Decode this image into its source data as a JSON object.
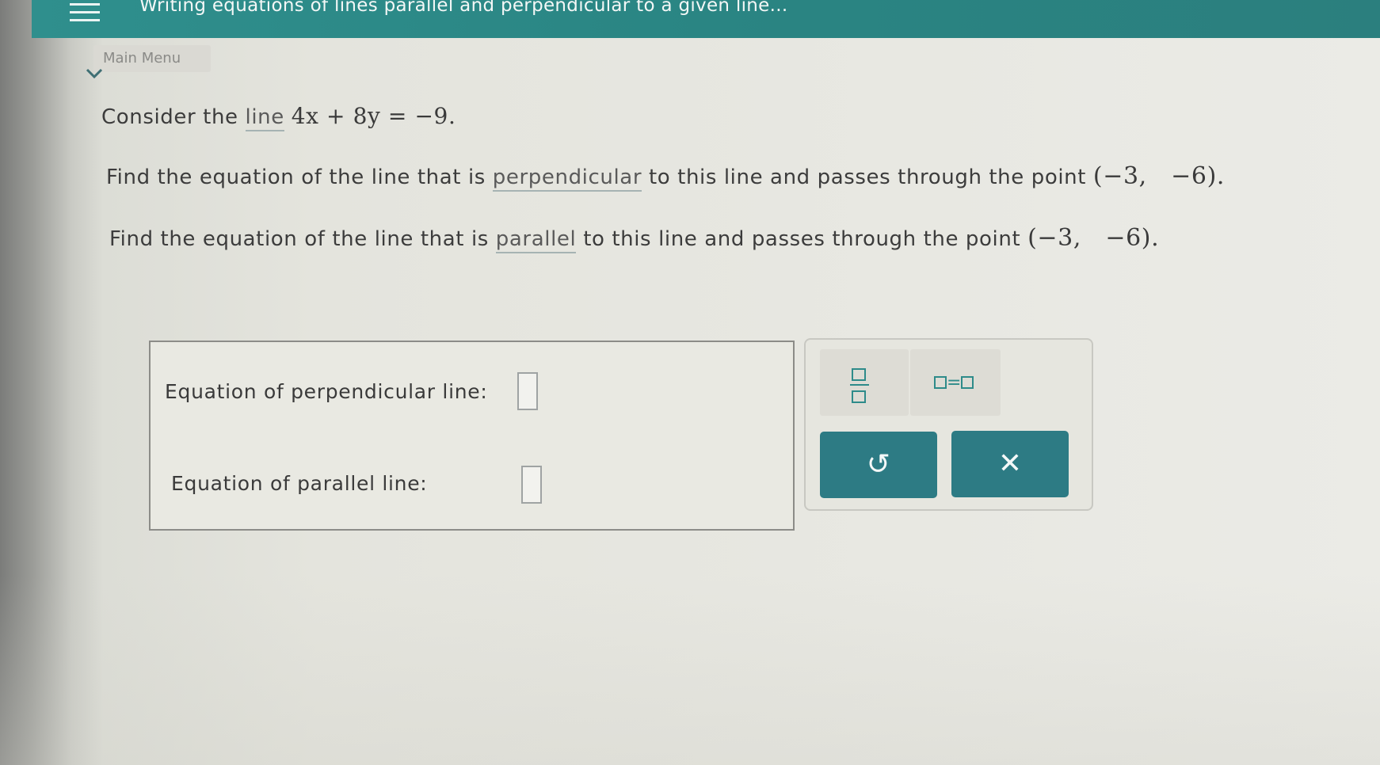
{
  "topbar": {
    "title": "Writing equations of lines parallel and perpendicular to a given line...",
    "menu_icon": "hamburger-icon"
  },
  "main_menu": {
    "label": "Main Menu",
    "icon": "chevron-down-icon"
  },
  "question": {
    "line1_prefix": "Consider the ",
    "line1_link": "line",
    "line1_math": "4x + 8y = −9.",
    "line2_prefix": "Find the equation of the line that is ",
    "line2_link": "perpendicular",
    "line2_suffix": " to this line and passes through the point ",
    "line2_point": "(−3,   −6).",
    "line3_prefix": "Find the equation of the line that is ",
    "line3_link": "parallel",
    "line3_suffix": " to this line and passes through the point ",
    "line3_point": "(−3,   −6)."
  },
  "answers": {
    "perpendicular_label": "Equation of perpendicular line:",
    "perpendicular_value": "",
    "parallel_label": "Equation of parallel line:",
    "parallel_value": ""
  },
  "tools": {
    "fraction_icon": "fraction-icon",
    "equation_icon": "equation-icon",
    "equals_sign": "=",
    "undo_icon": "undo-icon",
    "undo_glyph": "↺",
    "clear_icon": "close-icon",
    "clear_glyph": "✕"
  },
  "colors": {
    "accent": "#2d7b84",
    "topbar": "#2a8583"
  }
}
